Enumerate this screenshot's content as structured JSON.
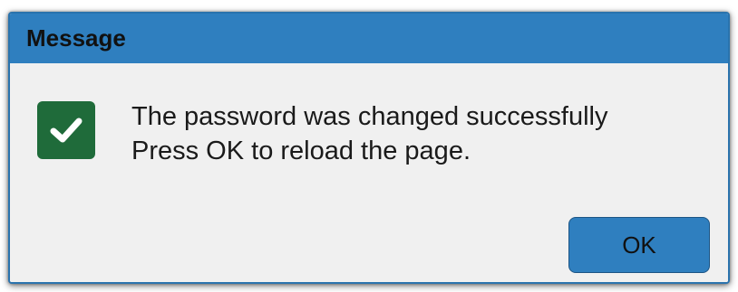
{
  "dialog": {
    "title": "Message",
    "message_lines": [
      "The password was changed successfully",
      "Press OK to reload the page."
    ],
    "icon": "success-check-icon",
    "ok_label": "OK"
  },
  "colors": {
    "titlebar": "#2f7fbf",
    "icon_background": "#1f6b3a",
    "button": "#2f7fbf",
    "content_background": "#f0f0f0"
  }
}
